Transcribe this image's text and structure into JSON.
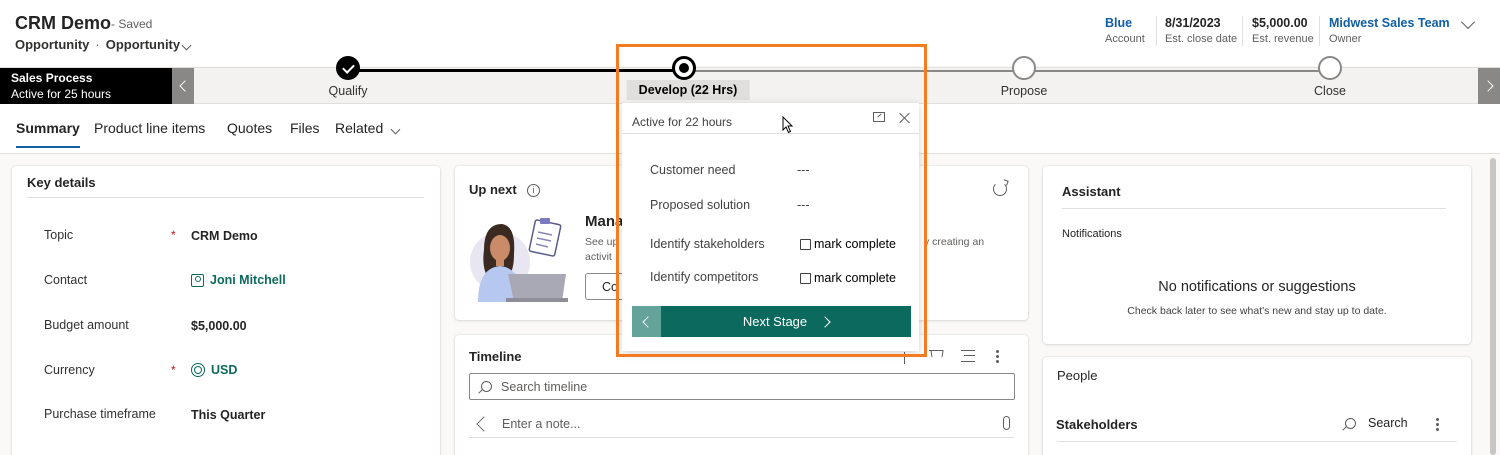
{
  "header": {
    "title": "CRM Demo",
    "saved": "- Saved",
    "entity": "Opportunity",
    "dot": "·",
    "form": "Opportunity",
    "fields": [
      {
        "value": "Blue",
        "label": "Account",
        "link": true
      },
      {
        "value": "8/31/2023",
        "label": "Est. close date",
        "link": false
      },
      {
        "value": "$5,000.00",
        "label": "Est. revenue",
        "link": false
      },
      {
        "value": "Midwest Sales Team",
        "label": "Owner",
        "link": true
      }
    ]
  },
  "process": {
    "title": "Sales Process",
    "subtitle": "Active for 25 hours",
    "stages": [
      {
        "label": "Qualify",
        "state": "done"
      },
      {
        "label": "Develop  (22 Hrs)",
        "state": "active"
      },
      {
        "label": "Propose",
        "state": "pending"
      },
      {
        "label": "Close",
        "state": "pending"
      }
    ]
  },
  "tabs": [
    "Summary",
    "Product line items",
    "Quotes",
    "Files",
    "Related"
  ],
  "key_details": {
    "title": "Key details",
    "rows": [
      {
        "label": "Topic",
        "value": "CRM Demo",
        "required": true
      },
      {
        "label": "Contact",
        "value": "Joni Mitchell",
        "required": false
      },
      {
        "label": "Budget amount",
        "value": "$5,000.00",
        "required": false
      },
      {
        "label": "Currency",
        "value": "USD",
        "required": true
      },
      {
        "label": "Purchase timeframe",
        "value": "This Quarter",
        "required": false
      }
    ],
    "required_mark": "*"
  },
  "up_next": {
    "title": "Up next",
    "info": "i",
    "heading": "Mana",
    "text_left": "See up",
    "text_left2": "activit",
    "text_right": "y creating an",
    "button": "Co"
  },
  "timeline": {
    "title": "Timeline",
    "search_placeholder": "Search timeline",
    "note_placeholder": "Enter a note..."
  },
  "assistant": {
    "title": "Assistant",
    "notifications_label": "Notifications",
    "empty_title": "No notifications or suggestions",
    "empty_text": "Check back later to see what's new and stay up to date."
  },
  "people": {
    "title": "People",
    "stakeholders": "Stakeholders",
    "search": "Search"
  },
  "flyout": {
    "active": "Active for 22 hours",
    "rows": [
      {
        "label": "Customer need",
        "value": "---"
      },
      {
        "label": "Proposed solution",
        "value": "---"
      }
    ],
    "checks": [
      {
        "label": "Identify stakeholders",
        "check_label": "mark complete"
      },
      {
        "label": "Identify competitors",
        "check_label": "mark complete"
      }
    ],
    "next_stage": "Next Stage"
  },
  "colors": {
    "accent": "#0b6a5d",
    "highlight": "#f47b20",
    "link": "#115ea3"
  }
}
